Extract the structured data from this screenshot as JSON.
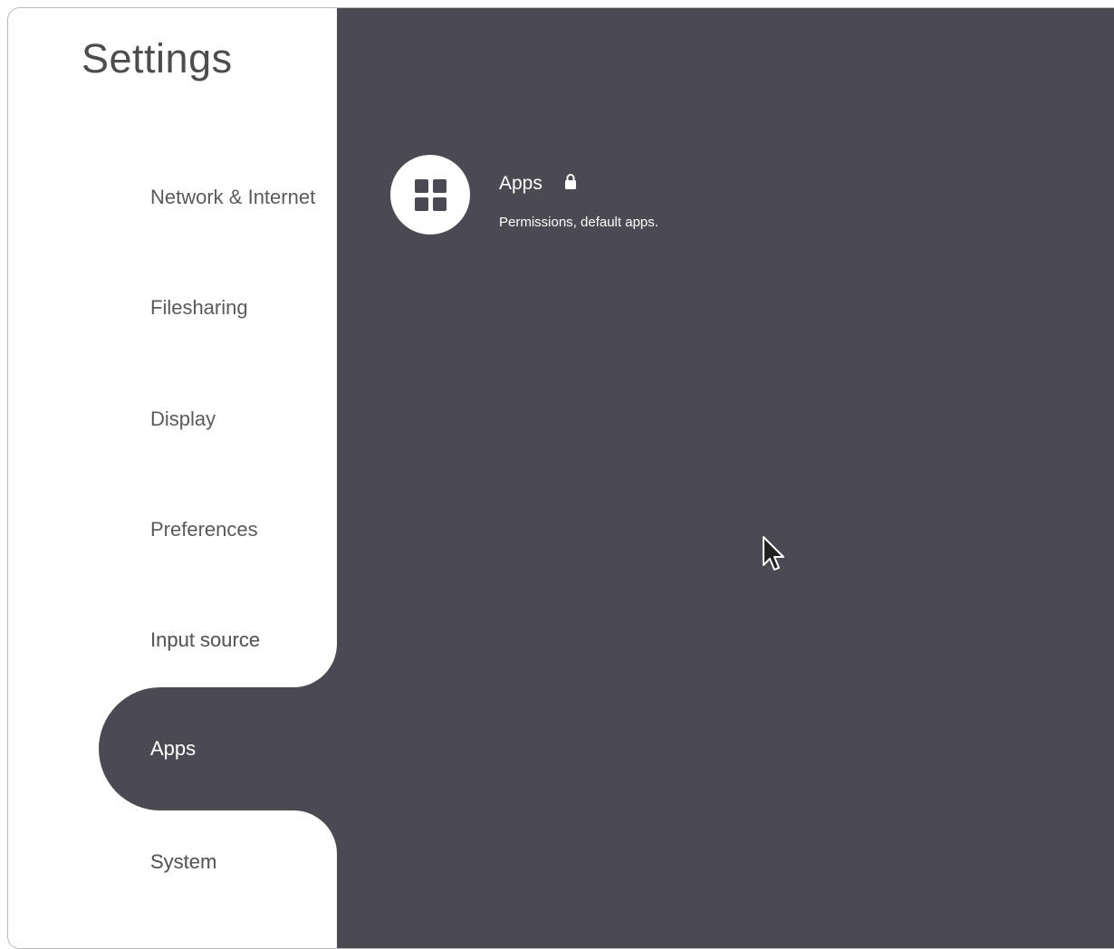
{
  "header": {
    "title": "Settings"
  },
  "sidebar": {
    "items": [
      {
        "label": "Network & Internet"
      },
      {
        "label": "Filesharing"
      },
      {
        "label": "Display"
      },
      {
        "label": "Preferences"
      },
      {
        "label": "Input source"
      },
      {
        "label": "Apps",
        "selected": true
      },
      {
        "label": "System"
      }
    ]
  },
  "main": {
    "entry": {
      "icon": "apps-grid-icon",
      "title": "Apps",
      "lock_icon": "lock-icon",
      "subtitle": "Permissions, default apps."
    }
  },
  "colors": {
    "panel_background": "#4b4a52",
    "sidebar_background": "#ffffff",
    "text_dark": "#5a5a5a",
    "text_light": "#ffffff"
  }
}
